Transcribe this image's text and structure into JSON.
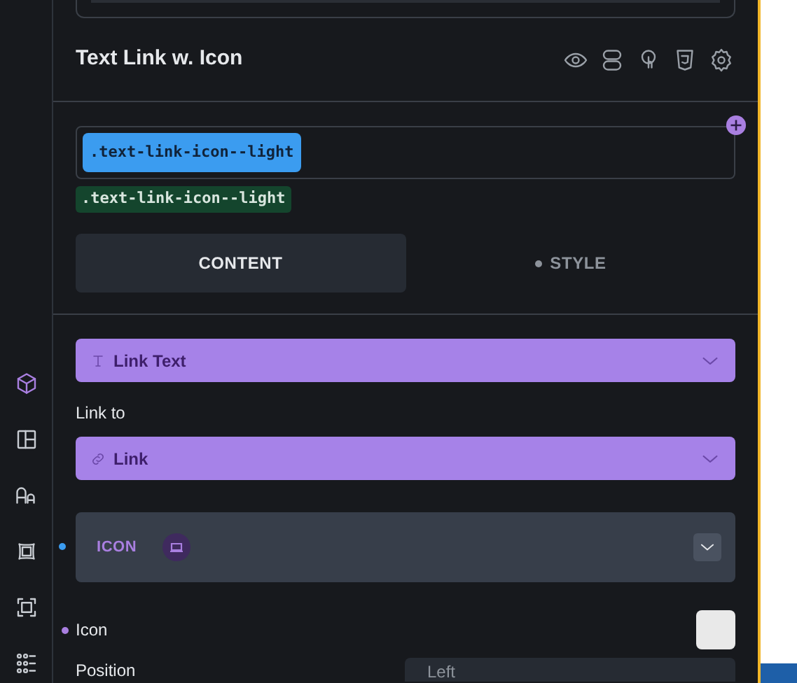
{
  "element": {
    "title": "Text Link w. Icon"
  },
  "classes": {
    "selector": ".text-link-icon--light",
    "active_class": ".text-link-icon--light"
  },
  "tabs": [
    {
      "label": "CONTENT",
      "selected": true,
      "modified": false
    },
    {
      "label": "STYLE",
      "selected": false,
      "modified": true
    }
  ],
  "rail": [
    {
      "selected": true
    },
    {
      "selected": false
    },
    {
      "selected": false
    },
    {
      "selected": false
    },
    {
      "selected": false
    },
    {
      "selected": false
    }
  ],
  "controls": [
    {
      "kind": "dropdown",
      "label": "Link Text"
    },
    {
      "kind": "label",
      "label": "Link to"
    },
    {
      "kind": "dropdown",
      "label": "Link"
    },
    {
      "kind": "section",
      "label": "ICON",
      "modified": true,
      "expanded": false
    },
    {
      "kind": "swatch",
      "label": "Icon",
      "modified": true
    },
    {
      "kind": "select",
      "label": "Position",
      "value": "Left"
    }
  ]
}
